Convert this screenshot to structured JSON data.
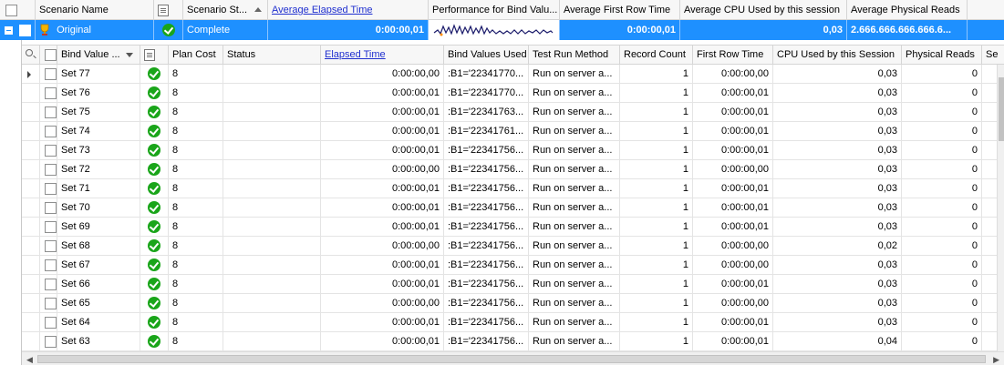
{
  "outer_grid": {
    "columns": [
      {
        "label": ""
      },
      {
        "label": "Scenario Name"
      },
      {
        "label": ""
      },
      {
        "label": "Scenario St..."
      },
      {
        "label": "Average Elapsed Time"
      },
      {
        "label": "Performance for Bind Valu..."
      },
      {
        "label": "Average First Row Time"
      },
      {
        "label": "Average CPU Used by this session"
      },
      {
        "label": "Average Physical Reads"
      }
    ],
    "row": {
      "scenario_name": "Original",
      "status": "Complete",
      "avg_elapsed": "0:00:00,01",
      "avg_first_row": "0:00:00,01",
      "avg_cpu": "0,03",
      "avg_physical_reads": "2.666.666.666.666.6..."
    }
  },
  "detail_grid": {
    "columns": {
      "bind_value": "Bind Value ...",
      "plan_cost": "Plan Cost",
      "status": "Status",
      "elapsed_time": "Elapsed Time",
      "bind_values_used": "Bind Values Used",
      "test_run_method": "Test Run Method",
      "record_count": "Record Count",
      "first_row_time": "First Row Time",
      "cpu_used": "CPU Used by this Session",
      "physical_reads": "Physical Reads",
      "more": "Se"
    },
    "rows": [
      {
        "set": "Set 77",
        "plan_cost": "8",
        "elapsed": "0:00:00,00",
        "bind": ":B1='22341770...",
        "method": "Run on server a...",
        "records": "1",
        "first_row": "0:00:00,00",
        "cpu": "0,03",
        "phys": "0"
      },
      {
        "set": "Set 76",
        "plan_cost": "8",
        "elapsed": "0:00:00,01",
        "bind": ":B1='22341770...",
        "method": "Run on server a...",
        "records": "1",
        "first_row": "0:00:00,01",
        "cpu": "0,03",
        "phys": "0"
      },
      {
        "set": "Set 75",
        "plan_cost": "8",
        "elapsed": "0:00:00,01",
        "bind": ":B1='22341763...",
        "method": "Run on server a...",
        "records": "1",
        "first_row": "0:00:00,01",
        "cpu": "0,03",
        "phys": "0"
      },
      {
        "set": "Set 74",
        "plan_cost": "8",
        "elapsed": "0:00:00,01",
        "bind": ":B1='22341761...",
        "method": "Run on server a...",
        "records": "1",
        "first_row": "0:00:00,01",
        "cpu": "0,03",
        "phys": "0"
      },
      {
        "set": "Set 73",
        "plan_cost": "8",
        "elapsed": "0:00:00,01",
        "bind": ":B1='22341756...",
        "method": "Run on server a...",
        "records": "1",
        "first_row": "0:00:00,01",
        "cpu": "0,03",
        "phys": "0"
      },
      {
        "set": "Set 72",
        "plan_cost": "8",
        "elapsed": "0:00:00,00",
        "bind": ":B1='22341756...",
        "method": "Run on server a...",
        "records": "1",
        "first_row": "0:00:00,00",
        "cpu": "0,03",
        "phys": "0"
      },
      {
        "set": "Set 71",
        "plan_cost": "8",
        "elapsed": "0:00:00,01",
        "bind": ":B1='22341756...",
        "method": "Run on server a...",
        "records": "1",
        "first_row": "0:00:00,01",
        "cpu": "0,03",
        "phys": "0"
      },
      {
        "set": "Set 70",
        "plan_cost": "8",
        "elapsed": "0:00:00,01",
        "bind": ":B1='22341756...",
        "method": "Run on server a...",
        "records": "1",
        "first_row": "0:00:00,01",
        "cpu": "0,03",
        "phys": "0"
      },
      {
        "set": "Set 69",
        "plan_cost": "8",
        "elapsed": "0:00:00,01",
        "bind": ":B1='22341756...",
        "method": "Run on server a...",
        "records": "1",
        "first_row": "0:00:00,01",
        "cpu": "0,03",
        "phys": "0"
      },
      {
        "set": "Set 68",
        "plan_cost": "8",
        "elapsed": "0:00:00,00",
        "bind": ":B1='22341756...",
        "method": "Run on server a...",
        "records": "1",
        "first_row": "0:00:00,00",
        "cpu": "0,02",
        "phys": "0"
      },
      {
        "set": "Set 67",
        "plan_cost": "8",
        "elapsed": "0:00:00,01",
        "bind": ":B1='22341756...",
        "method": "Run on server a...",
        "records": "1",
        "first_row": "0:00:00,00",
        "cpu": "0,03",
        "phys": "0"
      },
      {
        "set": "Set 66",
        "plan_cost": "8",
        "elapsed": "0:00:00,01",
        "bind": ":B1='22341756...",
        "method": "Run on server a...",
        "records": "1",
        "first_row": "0:00:00,01",
        "cpu": "0,03",
        "phys": "0"
      },
      {
        "set": "Set 65",
        "plan_cost": "8",
        "elapsed": "0:00:00,00",
        "bind": ":B1='22341756...",
        "method": "Run on server a...",
        "records": "1",
        "first_row": "0:00:00,00",
        "cpu": "0,03",
        "phys": "0"
      },
      {
        "set": "Set 64",
        "plan_cost": "8",
        "elapsed": "0:00:00,01",
        "bind": ":B1='22341756...",
        "method": "Run on server a...",
        "records": "1",
        "first_row": "0:00:00,01",
        "cpu": "0,03",
        "phys": "0"
      },
      {
        "set": "Set 63",
        "plan_cost": "8",
        "elapsed": "0:00:00,01",
        "bind": ":B1='22341756...",
        "method": "Run on server a...",
        "records": "1",
        "first_row": "0:00:00,01",
        "cpu": "0,04",
        "phys": "0"
      }
    ]
  },
  "colors": {
    "selection": "#1e90ff",
    "link": "#1f2fcf",
    "status_ok": "#1aa51a"
  },
  "icons": {
    "status": "check-circle-icon",
    "notes": "note-icon",
    "scenario": "trophy-icon",
    "expand": "minus-box-icon"
  }
}
